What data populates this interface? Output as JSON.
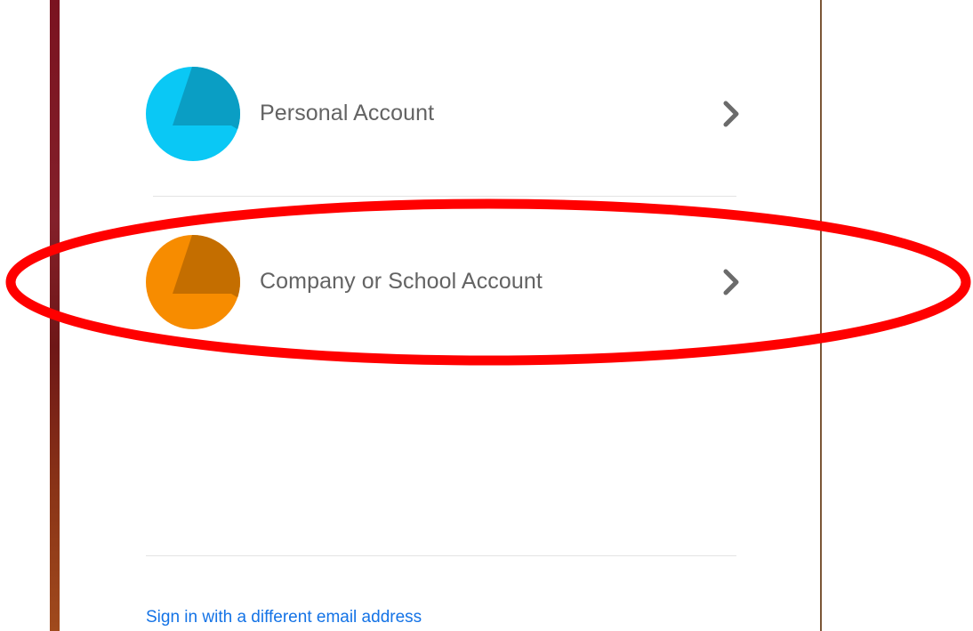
{
  "accounts": [
    {
      "label": "Personal Account",
      "color": "#0ac8f5",
      "shade": "#0a9ec4",
      "icon": "personal-account-icon"
    },
    {
      "label": "Company or School Account",
      "color": "#f78c00",
      "shade": "#c46e00",
      "icon": "company-account-icon"
    }
  ],
  "alt_signin": "Sign in with a different email address",
  "colors": {
    "link": "#1473e6",
    "label": "#636363",
    "chevron": "#6b6b6b",
    "highlight": "#ff0000"
  }
}
